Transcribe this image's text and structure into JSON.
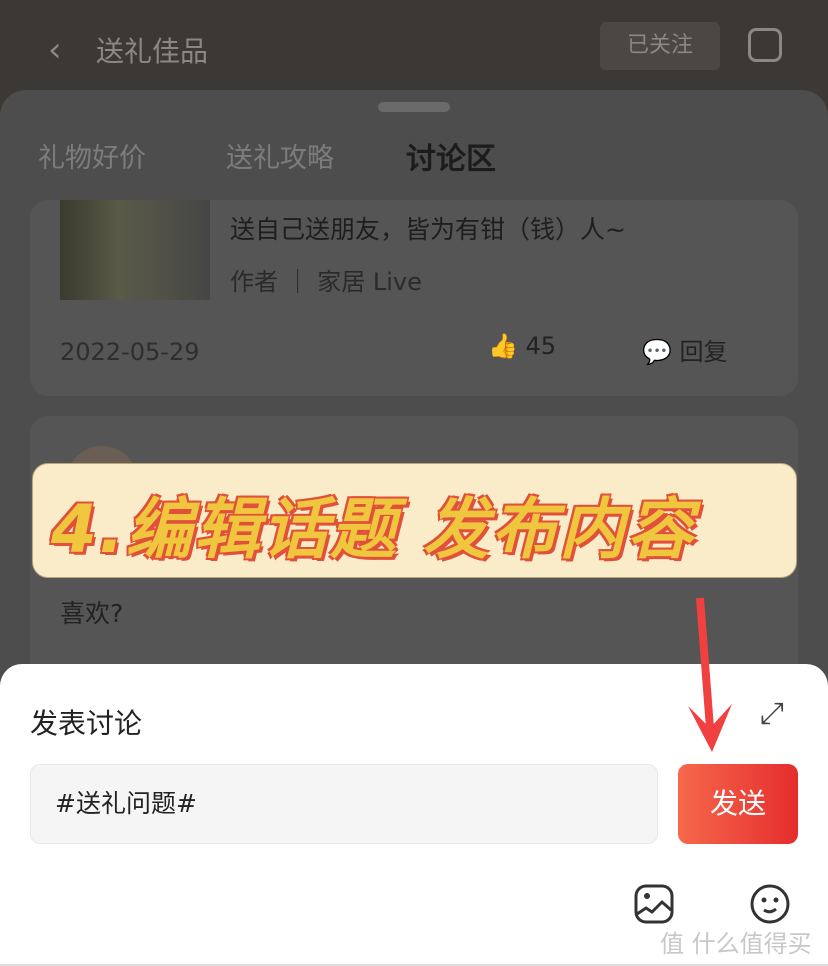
{
  "header": {
    "title": "送礼佳品",
    "follow_label": "已关注"
  },
  "tabs": [
    {
      "label": "礼物好价"
    },
    {
      "label": "送礼攻略"
    },
    {
      "label": "讨论区",
      "active": true
    }
  ],
  "post1": {
    "title": "送自己送朋友，皆为有钳（钱）人~",
    "meta": "作者 ｜ 家居 Live",
    "date": "2022-05-29",
    "likes": "45",
    "reply_label": "回复"
  },
  "post2": {
    "text_visible": "喜欢?"
  },
  "banner": {
    "text": "4.编辑话题 发布内容"
  },
  "composer": {
    "title": "发表讨论",
    "input_value": "#送礼问题#",
    "send_label": "发送"
  },
  "watermark": "值 什么值得买",
  "colors": {
    "accent": "#e8362f",
    "banner_text": "#efc63d",
    "banner_bg": "#fbecc9"
  }
}
